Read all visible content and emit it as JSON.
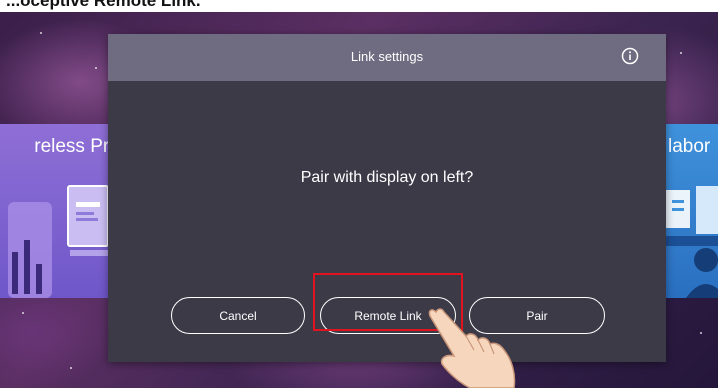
{
  "caption": {
    "text": "...oceptive Remote Link."
  },
  "background": {
    "left_app_title": "reless Proj",
    "right_app_title": "labor"
  },
  "dialog": {
    "title": "Link settings",
    "info_icon": "info-circle-icon",
    "message": "Pair with display on left?",
    "buttons": {
      "cancel": "Cancel",
      "remote_link": "Remote Link",
      "pair": "Pair"
    }
  },
  "annotation": {
    "highlight_color": "#e0141e",
    "pointer_icon": "pointing-hand-icon"
  },
  "colors": {
    "dialog_background": "#3d3a48",
    "dialog_header": "#6f6b80",
    "text": "#ffffff"
  }
}
